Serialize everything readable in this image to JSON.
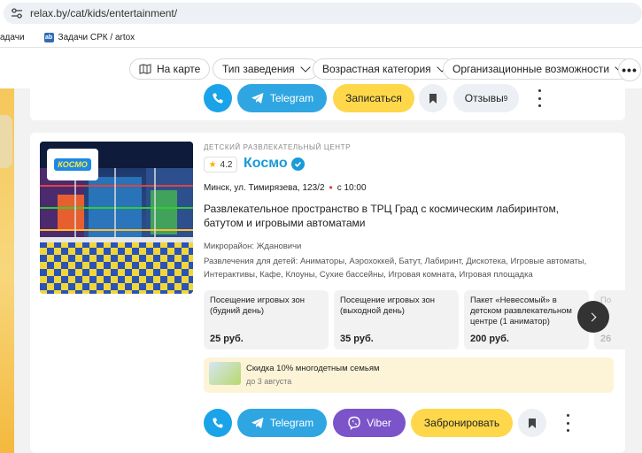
{
  "browser": {
    "url": "relax.by/cat/kids/entertainment/",
    "bookmarks": [
      {
        "label": "адачи"
      },
      {
        "label": "Задачи СРК / artox",
        "favicon": "ab"
      }
    ]
  },
  "filters": {
    "map_label": "На карте",
    "items": [
      "Тип заведения",
      "Возрастная категория",
      "Организационные возможности"
    ],
    "more": "•••"
  },
  "top_card": {
    "telegram": "Telegram",
    "signup": "Записаться",
    "reviews": "Отзывы",
    "reviews_count": "9"
  },
  "listing": {
    "category": "ДЕТСКИЙ РАЗВЛЕКАТЕЛЬНЫЙ ЦЕНТР",
    "rating": "4.2",
    "name": "Космо",
    "logo_text": "КОСМО",
    "address": "Минск, ул. Тимирязева, 123/2",
    "hours": "с 10:00",
    "description": "Развлекательное пространство в ТРЦ Град с космическим лабиринтом, батутом и игровыми автоматами",
    "district": "Микрорайон: Ждановичи",
    "activities": "Развлечения для детей: Аниматоры, Аэрохоккей, Батут, Лабиринт, Дискотека, Игровые автоматы, Интерактивы, Кафе, Клоуны, Сухие бассейны, Игровая комната, Игровая площадка",
    "prices": [
      {
        "name": "Посещение игровых зон (будний день)",
        "value": "25 руб."
      },
      {
        "name": "Посещение игровых зон (выходной день)",
        "value": "35 руб."
      },
      {
        "name": "Пакет «Невесомый» в детском развлекательном центре (1 аниматор)",
        "value": "200 руб."
      },
      {
        "name": "По",
        "value": "26"
      }
    ],
    "promo": {
      "title": "Скидка 10% многодетным семьям",
      "date": "до 3 августа"
    },
    "buttons": {
      "telegram": "Telegram",
      "viber": "Viber",
      "book": "Забронировать"
    }
  },
  "colors": {
    "accent_blue": "#1a9ad8",
    "telegram": "#2fa6e2",
    "viber": "#7b54c9",
    "yellow": "#fed74a"
  }
}
